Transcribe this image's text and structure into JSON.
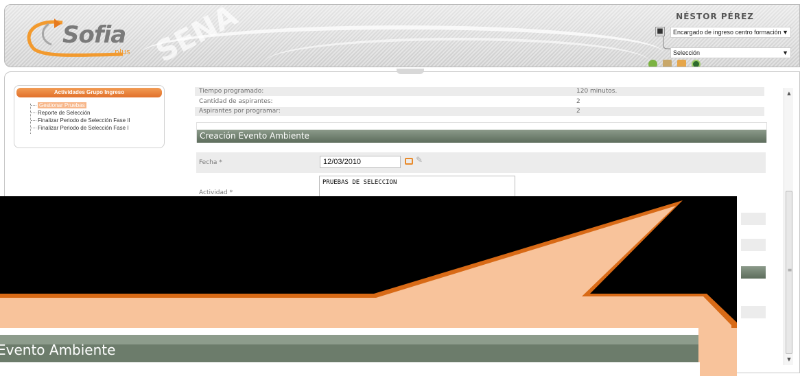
{
  "header": {
    "logo_text": "Sofia",
    "logo_sub": "plus",
    "user_name": "NÉSTOR PÉREZ",
    "role_select": "Encargado de ingreso centro formación",
    "module_select": "Selección"
  },
  "menu": {
    "title": "Actividades Grupo Ingreso",
    "items": [
      {
        "label": "Gestionar Pruebas"
      },
      {
        "label": "Reporte de Selección"
      },
      {
        "label": "Finalizar Periodo de Selección Fase II"
      },
      {
        "label": "Finalizar Periodo de Selección Fase I"
      }
    ]
  },
  "form": {
    "rows": [
      {
        "label": "Tiempo programado:",
        "value": "120 minutos."
      },
      {
        "label": "Cantidad de aspirantes:",
        "value": "2"
      },
      {
        "label": "Aspirantes por programar:",
        "value": "2"
      }
    ],
    "section_title": "Creación Evento Ambiente",
    "fecha_label": "Fecha *",
    "fecha_value": "12/03/2010",
    "actividad_label": "Actividad *",
    "actividad_value": "PRUEBAS DE SELECCION"
  },
  "callout": {
    "zoom_text": "Evento Ambiente",
    "colors": {
      "fill": "#f8c39b",
      "edge": "#d86a16",
      "bg": "#000000"
    }
  }
}
